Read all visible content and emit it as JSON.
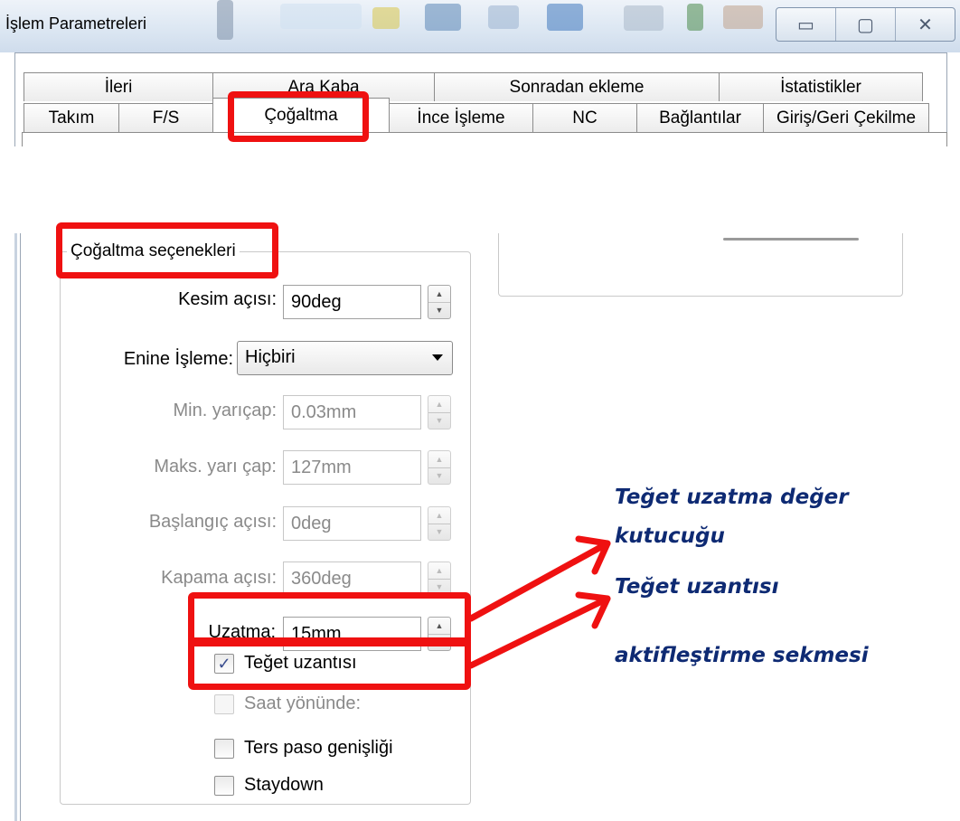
{
  "window": {
    "title": "İşlem Parametreleri",
    "buttons": {
      "minimize": "▭",
      "maximize": "▢",
      "close": "✕"
    }
  },
  "tabs": {
    "row1": [
      "İleri",
      "Ara Kaba",
      "Sonradan ekleme",
      "İstatistikler"
    ],
    "row2": [
      "Takım",
      "F/S",
      "Çoğaltma",
      "İnce İşleme",
      "NC",
      "Bağlantılar",
      "Giriş/Geri Çekilme"
    ],
    "active": "Çoğaltma"
  },
  "group": {
    "title": "Çoğaltma seçenekleri",
    "kesim_acisi": {
      "label": "Kesim açısı:",
      "value": "90deg"
    },
    "enine_isleme": {
      "label": "Enine İşleme:",
      "value": "Hiçbiri"
    },
    "min_yaricap": {
      "label": "Min. yarıçap:",
      "value": "0.03mm"
    },
    "maks_yaricap": {
      "label": "Maks. yarı çap:",
      "value": "127mm"
    },
    "baslangic_acisi": {
      "label": "Başlangıç açısı:",
      "value": "0deg"
    },
    "kapama_acisi": {
      "label": "Kapama açısı:",
      "value": "360deg"
    },
    "uzatma": {
      "label": "Uzatma:",
      "value": "15mm"
    },
    "teget_uzantisi": {
      "label": "Teğet uzantısı",
      "checked": true
    },
    "saat_yonunde": {
      "label": "Saat yönünde:",
      "checked": false
    },
    "ters_paso": {
      "label": "Ters paso genişliği",
      "checked": false
    },
    "staydown": {
      "label": "Staydown",
      "checked": false
    }
  },
  "annotations": {
    "note1_line1": "Teğet uzatma değer",
    "note1_line2": "kutucuğu",
    "note2_line1": "Teğet uzantısı",
    "note2_line2": "aktifleştirme sekmesi",
    "color": "#ef1111"
  }
}
